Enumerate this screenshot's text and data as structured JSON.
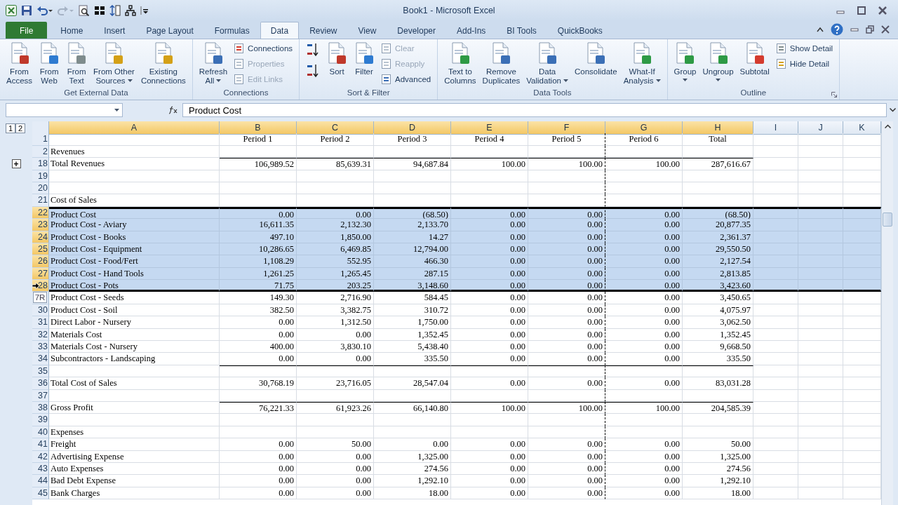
{
  "window": {
    "title": "Book1  -  Microsoft Excel"
  },
  "ribbon": {
    "tabs": [
      {
        "label": "File",
        "kind": "file",
        "selected": false
      },
      {
        "label": "Home",
        "kind": "tab",
        "selected": false
      },
      {
        "label": "Insert",
        "kind": "tab",
        "selected": false
      },
      {
        "label": "Page Layout",
        "kind": "tab",
        "selected": false
      },
      {
        "label": "Formulas",
        "kind": "tab",
        "selected": false
      },
      {
        "label": "Data",
        "kind": "tab",
        "selected": true
      },
      {
        "label": "Review",
        "kind": "tab",
        "selected": false
      },
      {
        "label": "View",
        "kind": "tab",
        "selected": false
      },
      {
        "label": "Developer",
        "kind": "tab",
        "selected": false
      },
      {
        "label": "Add-Ins",
        "kind": "tab",
        "selected": false
      },
      {
        "label": "BI Tools",
        "kind": "tab",
        "selected": false
      },
      {
        "label": "QuickBooks",
        "kind": "tab",
        "selected": false
      }
    ],
    "groups": [
      {
        "label": "Get External Data",
        "launcher": false,
        "items": [
          {
            "kind": "large",
            "lines": [
              "From",
              "Access"
            ],
            "menu": false,
            "disabled": false
          },
          {
            "kind": "large",
            "lines": [
              "From",
              "Web"
            ],
            "menu": false,
            "disabled": false
          },
          {
            "kind": "large",
            "lines": [
              "From",
              "Text"
            ],
            "menu": false,
            "disabled": false
          },
          {
            "kind": "large",
            "lines": [
              "From Other",
              "Sources"
            ],
            "menu": true,
            "disabled": false
          },
          {
            "kind": "large",
            "lines": [
              "Existing",
              "Connections"
            ],
            "menu": false,
            "disabled": false
          }
        ]
      },
      {
        "label": "Connections",
        "launcher": false,
        "items": [
          {
            "kind": "large",
            "lines": [
              "Refresh",
              "All"
            ],
            "menu": true,
            "disabled": false
          },
          {
            "kind": "small",
            "lines": [
              "Connections"
            ],
            "menu": false,
            "disabled": false
          },
          {
            "kind": "small",
            "lines": [
              "Properties"
            ],
            "menu": false,
            "disabled": true
          },
          {
            "kind": "small",
            "lines": [
              "Edit Links"
            ],
            "menu": false,
            "disabled": true
          }
        ]
      },
      {
        "label": "Sort & Filter",
        "launcher": false,
        "items": [
          {
            "kind": "icon",
            "disabled": false
          },
          {
            "kind": "icon",
            "disabled": false
          },
          {
            "kind": "large",
            "lines": [
              "Sort"
            ],
            "menu": false,
            "disabled": false
          },
          {
            "kind": "large",
            "lines": [
              "Filter"
            ],
            "menu": false,
            "disabled": false
          },
          {
            "kind": "small",
            "lines": [
              "Clear"
            ],
            "menu": false,
            "disabled": true
          },
          {
            "kind": "small",
            "lines": [
              "Reapply"
            ],
            "menu": false,
            "disabled": true
          },
          {
            "kind": "small",
            "lines": [
              "Advanced"
            ],
            "menu": false,
            "disabled": false
          }
        ]
      },
      {
        "label": "Data Tools",
        "launcher": false,
        "items": [
          {
            "kind": "large",
            "lines": [
              "Text to",
              "Columns"
            ],
            "menu": false,
            "disabled": false
          },
          {
            "kind": "large",
            "lines": [
              "Remove",
              "Duplicates"
            ],
            "menu": false,
            "disabled": false
          },
          {
            "kind": "large",
            "lines": [
              "Data",
              "Validation"
            ],
            "menu": true,
            "disabled": false
          },
          {
            "kind": "large",
            "lines": [
              "Consolidate"
            ],
            "menu": false,
            "disabled": false
          },
          {
            "kind": "large",
            "lines": [
              "What-If",
              "Analysis"
            ],
            "menu": true,
            "disabled": false
          }
        ]
      },
      {
        "label": "Outline",
        "launcher": true,
        "items": [
          {
            "kind": "large",
            "lines": [
              "Group"
            ],
            "menu": true,
            "disabled": false
          },
          {
            "kind": "large",
            "lines": [
              "Ungroup"
            ],
            "menu": true,
            "disabled": false
          },
          {
            "kind": "large",
            "lines": [
              "Subtotal"
            ],
            "menu": false,
            "disabled": false
          },
          {
            "kind": "small",
            "lines": [
              "Show Detail"
            ],
            "menu": false,
            "disabled": false
          },
          {
            "kind": "small",
            "lines": [
              "Hide Detail"
            ],
            "menu": false,
            "disabled": false
          }
        ]
      }
    ]
  },
  "formula_bar": {
    "value": "Product Cost"
  },
  "sheet": {
    "outline_levels": [
      "1",
      "2"
    ],
    "columns": [
      {
        "letter": "A",
        "highlighted": true,
        "page_break": false
      },
      {
        "letter": "B",
        "highlighted": true,
        "page_break": false
      },
      {
        "letter": "C",
        "highlighted": true,
        "page_break": false
      },
      {
        "letter": "D",
        "highlighted": true,
        "page_break": false
      },
      {
        "letter": "E",
        "highlighted": true,
        "page_break": false
      },
      {
        "letter": "F",
        "highlighted": true,
        "page_break": true
      },
      {
        "letter": "G",
        "highlighted": true,
        "page_break": false
      },
      {
        "letter": "H",
        "highlighted": true,
        "page_break": false
      },
      {
        "letter": "I",
        "highlighted": false,
        "page_break": false
      },
      {
        "letter": "J",
        "highlighted": false,
        "page_break": false
      },
      {
        "letter": "K",
        "highlighted": false,
        "page_break": false
      }
    ],
    "rows": [
      {
        "number": "1",
        "kind": "header",
        "values": [
          "Period 1",
          "Period 2",
          "Period 3",
          "Period 4",
          "Period 5",
          "Period 6",
          "Total"
        ],
        "selected": false,
        "rule_above": false
      },
      {
        "number": "2",
        "kind": "data",
        "label": "Revenues",
        "selected": false,
        "rule_above": false
      },
      {
        "number": "18",
        "kind": "data",
        "label": "Total Revenues",
        "values": [
          "106,989.52",
          "85,639.31",
          "94,687.84",
          "100.00",
          "100.00",
          "100.00",
          "287,616.67"
        ],
        "selected": false,
        "rule_above": true,
        "outline_button": "+"
      },
      {
        "number": "19",
        "kind": "data",
        "selected": false,
        "rule_above": false
      },
      {
        "number": "20",
        "kind": "data",
        "selected": false,
        "rule_above": false
      },
      {
        "number": "21",
        "kind": "data",
        "label": "Cost of Sales",
        "selected": false,
        "rule_above": false
      },
      {
        "number": "22",
        "kind": "data",
        "label": "Product Cost",
        "values": [
          "0.00",
          "0.00",
          "(68.50)",
          "0.00",
          "0.00",
          "0.00",
          "(68.50)"
        ],
        "selected": true,
        "rule_above": false
      },
      {
        "number": "23",
        "kind": "data",
        "label": "Product Cost - Aviary",
        "values": [
          "16,611.35",
          "2,132.30",
          "2,133.70",
          "0.00",
          "0.00",
          "0.00",
          "20,877.35"
        ],
        "selected": true,
        "rule_above": false
      },
      {
        "number": "24",
        "kind": "data",
        "label": "Product Cost - Books",
        "values": [
          "497.10",
          "1,850.00",
          "14.27",
          "0.00",
          "0.00",
          "0.00",
          "2,361.37"
        ],
        "selected": true,
        "rule_above": false
      },
      {
        "number": "25",
        "kind": "data",
        "label": "Product Cost - Equipment",
        "values": [
          "10,286.65",
          "6,469.85",
          "12,794.00",
          "0.00",
          "0.00",
          "0.00",
          "29,550.50"
        ],
        "selected": true,
        "rule_above": false
      },
      {
        "number": "26",
        "kind": "data",
        "label": "Product Cost - Food/Fert",
        "values": [
          "1,108.29",
          "552.95",
          "466.30",
          "0.00",
          "0.00",
          "0.00",
          "2,127.54"
        ],
        "selected": true,
        "rule_above": false
      },
      {
        "number": "27",
        "kind": "data",
        "label": "Product Cost - Hand Tools",
        "values": [
          "1,261.25",
          "1,265.45",
          "287.15",
          "0.00",
          "0.00",
          "0.00",
          "2,813.85"
        ],
        "selected": true,
        "rule_above": false
      },
      {
        "number": "28",
        "kind": "data",
        "label": "Product Cost - Pots",
        "values": [
          "71.75",
          "203.25",
          "3,148.60",
          "0.00",
          "0.00",
          "0.00",
          "3,423.60"
        ],
        "selected": true,
        "rule_above": false,
        "cursor": true
      },
      {
        "kind": "data",
        "label": "Product Cost - Seeds",
        "values": [
          "149.30",
          "2,716.90",
          "584.45",
          "0.00",
          "0.00",
          "0.00",
          "3,450.65"
        ],
        "selected": false,
        "rule_above": false,
        "tooltip": "7R"
      },
      {
        "number": "30",
        "kind": "data",
        "label": "Product Cost - Soil",
        "values": [
          "382.50",
          "3,382.75",
          "310.72",
          "0.00",
          "0.00",
          "0.00",
          "4,075.97"
        ],
        "selected": false,
        "rule_above": false
      },
      {
        "number": "31",
        "kind": "data",
        "label": "Direct Labor - Nursery",
        "values": [
          "0.00",
          "1,312.50",
          "1,750.00",
          "0.00",
          "0.00",
          "0.00",
          "3,062.50"
        ],
        "selected": false,
        "rule_above": false
      },
      {
        "number": "32",
        "kind": "data",
        "label": "Materials Cost",
        "values": [
          "0.00",
          "0.00",
          "1,352.45",
          "0.00",
          "0.00",
          "0.00",
          "1,352.45"
        ],
        "selected": false,
        "rule_above": false
      },
      {
        "number": "33",
        "kind": "data",
        "label": "Materials Cost - Nursery",
        "values": [
          "400.00",
          "3,830.10",
          "5,438.40",
          "0.00",
          "0.00",
          "0.00",
          "9,668.50"
        ],
        "selected": false,
        "rule_above": false
      },
      {
        "number": "34",
        "kind": "data",
        "label": "Subcontractors - Landscaping",
        "values": [
          "0.00",
          "0.00",
          "335.50",
          "0.00",
          "0.00",
          "0.00",
          "335.50"
        ],
        "selected": false,
        "rule_above": false
      },
      {
        "number": "35",
        "kind": "data",
        "selected": false,
        "rule_above": true
      },
      {
        "number": "36",
        "kind": "data",
        "label": "Total Cost of Sales",
        "values": [
          "30,768.19",
          "23,716.05",
          "28,547.04",
          "0.00",
          "0.00",
          "0.00",
          "83,031.28"
        ],
        "selected": false,
        "rule_above": false
      },
      {
        "number": "37",
        "kind": "data",
        "selected": false,
        "rule_above": false
      },
      {
        "number": "38",
        "kind": "data",
        "label": "Gross Profit",
        "values": [
          "76,221.33",
          "61,923.26",
          "66,140.80",
          "100.00",
          "100.00",
          "100.00",
          "204,585.39"
        ],
        "selected": false,
        "rule_above": true
      },
      {
        "number": "39",
        "kind": "data",
        "selected": false,
        "rule_above": false
      },
      {
        "number": "40",
        "kind": "data",
        "label": "Expenses",
        "selected": false,
        "rule_above": false
      },
      {
        "number": "41",
        "kind": "data",
        "label": "Freight",
        "values": [
          "0.00",
          "50.00",
          "0.00",
          "0.00",
          "0.00",
          "0.00",
          "50.00"
        ],
        "selected": false,
        "rule_above": false
      },
      {
        "number": "42",
        "kind": "data",
        "label": "Advertising Expense",
        "values": [
          "0.00",
          "0.00",
          "1,325.00",
          "0.00",
          "0.00",
          "0.00",
          "1,325.00"
        ],
        "selected": false,
        "rule_above": false
      },
      {
        "number": "43",
        "kind": "data",
        "label": "Auto Expenses",
        "values": [
          "0.00",
          "0.00",
          "274.56",
          "0.00",
          "0.00",
          "0.00",
          "274.56"
        ],
        "selected": false,
        "rule_above": false
      },
      {
        "number": "44",
        "kind": "data",
        "label": "Bad Debt Expense",
        "values": [
          "0.00",
          "0.00",
          "1,292.10",
          "0.00",
          "0.00",
          "0.00",
          "1,292.10"
        ],
        "selected": false,
        "rule_above": false
      },
      {
        "number": "45",
        "kind": "data",
        "label": "Bank Charges",
        "values": [
          "0.00",
          "0.00",
          "18.00",
          "0.00",
          "0.00",
          "0.00",
          "18.00"
        ],
        "selected": false,
        "rule_above": false
      }
    ]
  }
}
